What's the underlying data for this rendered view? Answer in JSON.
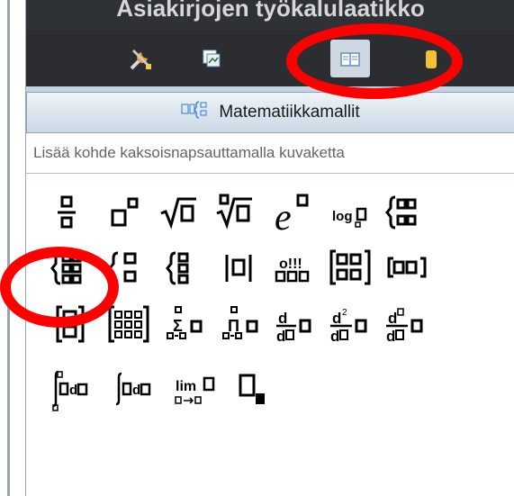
{
  "window": {
    "title": "Asiakirjojen työkalulaatikko"
  },
  "toolbar": {
    "buttons": [
      {
        "icon": "tools-icon",
        "active": false
      },
      {
        "icon": "pages-icon",
        "active": false
      },
      {
        "icon": "book-icon",
        "active": true
      },
      {
        "icon": "yellow-tab-icon",
        "active": false
      }
    ]
  },
  "section": {
    "title": "Matematiikkamallit",
    "icon": "math-templates-icon"
  },
  "hint": "Lisää kohde kaksoisnapsauttamalla kuvaketta",
  "templates": [
    "fraction-template-icon",
    "exponent-template-icon",
    "square-root-template-icon",
    "nth-root-template-icon",
    "e-exponent-template-icon",
    "log-template-icon",
    "piecewise-2-template-icon",
    "piecewise-n-template-icon",
    "system-2-template-icon",
    "system-n-template-icon",
    "absolute-value-template-icon",
    "dms-template-icon",
    "matrix-2x2-template-icon",
    "row-vector-template-icon",
    "column-vector-template-icon",
    "matrix-mxn-template-icon",
    "sum-template-icon",
    "product-template-icon",
    "first-derivative-template-icon",
    "second-derivative-template-icon",
    "nth-derivative-template-icon",
    "definite-integral-template-icon",
    "indefinite-integral-template-icon",
    "limit-template-icon",
    "subscript-template-icon"
  ],
  "annotations": {
    "highlight_color": "#ff0000"
  }
}
